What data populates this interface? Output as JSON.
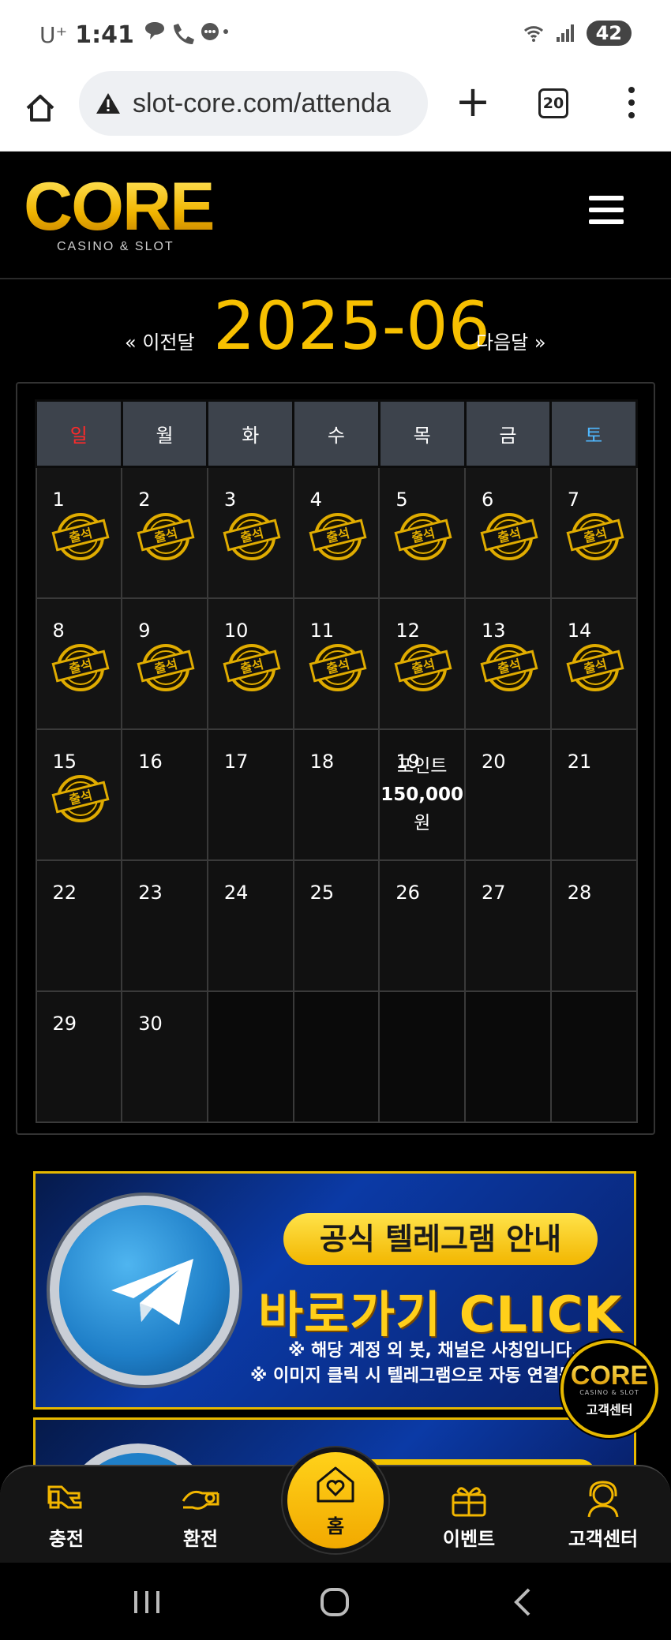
{
  "status_bar": {
    "carrier": "U⁺",
    "time": "1:41",
    "battery": "42"
  },
  "browser": {
    "url": "slot-core.com/attenda",
    "tab_count": "20"
  },
  "header": {
    "logo_text": "CORE",
    "logo_sub": "CASINO & SLOT"
  },
  "month_nav": {
    "prev_label": "« 이전달",
    "title": "2025-06",
    "next_label": "다음달 »"
  },
  "weekdays": [
    {
      "label": "일",
      "color": "#ff2a2a"
    },
    {
      "label": "월",
      "color": "#ffffff"
    },
    {
      "label": "화",
      "color": "#ffffff"
    },
    {
      "label": "수",
      "color": "#ffffff"
    },
    {
      "label": "목",
      "color": "#ffffff"
    },
    {
      "label": "금",
      "color": "#ffffff"
    },
    {
      "label": "토",
      "color": "#4fb8ff"
    }
  ],
  "calendar": {
    "stamp_label": "출석",
    "attended_days": [
      1,
      2,
      3,
      4,
      5,
      6,
      7,
      8,
      9,
      10,
      11,
      12,
      13,
      14,
      15
    ],
    "points": {
      "day": 19,
      "label": "포인트",
      "amount": "150,000",
      "unit": "원"
    },
    "weeks": [
      [
        "1",
        "2",
        "3",
        "4",
        "5",
        "6",
        "7"
      ],
      [
        "8",
        "9",
        "10",
        "11",
        "12",
        "13",
        "14"
      ],
      [
        "15",
        "16",
        "17",
        "18",
        "19",
        "20",
        "21"
      ],
      [
        "22",
        "23",
        "24",
        "25",
        "26",
        "27",
        "28"
      ],
      [
        "29",
        "30",
        "",
        "",
        "",
        "",
        ""
      ]
    ]
  },
  "banner": {
    "pill": "공식 텔레그램 안내",
    "main": "바로가기 CLICK",
    "note1": "※ 해당 계정 외 봇, 채널은 사칭입니다.",
    "note2": "※ 이미지 클릭 시 텔레그램으로 자동 연결됩니다."
  },
  "cs_fab": {
    "logo": "CORE",
    "sub": "CASINO & SLOT",
    "label": "고객센터"
  },
  "bottom_nav": {
    "charge": "충전",
    "exchange": "환전",
    "home": "홈",
    "event": "이벤트",
    "support": "고객센터"
  },
  "colors": {
    "accent_gold": "#f7c000",
    "sunday": "#ff2a2a",
    "saturday": "#4fb8ff",
    "background": "#000000"
  }
}
